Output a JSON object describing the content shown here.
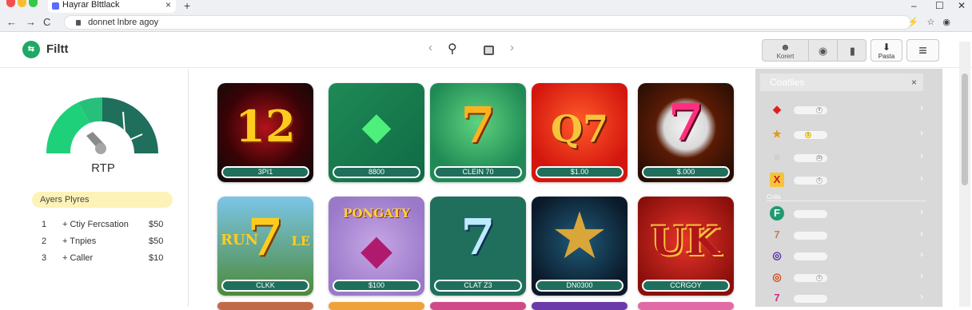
{
  "browser": {
    "tab_title": "Hayrar Blttlack",
    "url": "donnet lnbre agoy",
    "tab_close": "×",
    "new_tab": "+",
    "back": "←",
    "forward": "→",
    "reload": "C",
    "minimize": "–",
    "maximize": "☐",
    "close": "✕",
    "dots": [
      "#f44f4f",
      "#f8bd2e",
      "#37c84a"
    ]
  },
  "app": {
    "brand": "Filtt",
    "logo": "⇆",
    "prev": "‹",
    "next": "›",
    "search_icon": "⚲",
    "toolbar": {
      "seg1_label": "Korert",
      "btn_label": "Pasta"
    }
  },
  "left": {
    "gauge_label": "RTP",
    "players_title": "Ayers Plyres",
    "players": [
      {
        "rank": "1",
        "name": "+ Ctiy Fercsation",
        "value": "$50"
      },
      {
        "rank": "2",
        "name": "+ Tnpies",
        "value": "$50"
      },
      {
        "rank": "3",
        "name": "+ Caller",
        "value": "$10"
      }
    ],
    "gauge_level": 0.45,
    "colors": {
      "gauge_light": "#1fd07a",
      "gauge_dark": "#1f6f5c"
    }
  },
  "games": [
    {
      "glyph": "12",
      "label": "3PI1"
    },
    {
      "glyph": "◆",
      "label": "8800"
    },
    {
      "glyph": "7",
      "label": "CLEIN 70"
    },
    {
      "glyph": "Q7",
      "label": "$1.00"
    },
    {
      "glyph": "7",
      "label": "$.000"
    },
    {
      "glyph": "7",
      "label": "CLKK"
    },
    {
      "glyph": "◆",
      "label": "$100"
    },
    {
      "glyph": "7",
      "label": "CLAT Z3"
    },
    {
      "glyph": "★",
      "label": "DN0300"
    },
    {
      "glyph": "UK",
      "label": "CCRGOY"
    }
  ],
  "game_banners": {
    "g6_top": "RUN",
    "g6_side": "LE",
    "g7_top": "PONGATY"
  },
  "right": {
    "title": "Coatlles",
    "close": "×",
    "separator": "Cnlis",
    "rows": [
      {
        "icon": "◆",
        "knob": "8"
      },
      {
        "icon": "★",
        "knob": "1"
      },
      {
        "icon": "■",
        "knob": "30"
      },
      {
        "icon": "X",
        "knob": "0"
      },
      {
        "icon": "F",
        "knob": ""
      },
      {
        "icon": "7",
        "knob": ""
      },
      {
        "icon": "◎",
        "knob": ""
      },
      {
        "icon": "◎",
        "knob": "0"
      },
      {
        "icon": "7",
        "knob": ""
      }
    ],
    "chevron": "›"
  }
}
